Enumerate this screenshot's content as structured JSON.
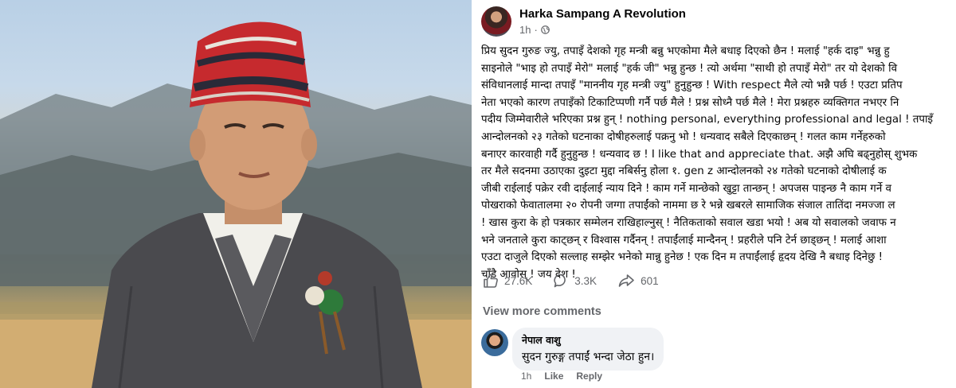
{
  "post": {
    "author": "Harka Sampang A Revolution",
    "time": "1h",
    "privacy_icon": "globe-icon",
    "lines": [
      "प्रिय सुदन गुरुङ ज्यु, तपाइँ देशको गृह मन्त्री बन्नु भएकोमा मैले बधाइ दिएको छैन ! मलाई \"हर्क दाइ\" भन्नु हु",
      "साइनोले \"भाइ हो तपाइँ मेरो\" मलाई \"हर्क जी\" भन्नु हुन्छ ! त्यो अर्थमा \"साथी हो तपाइँ मेरो\" तर यो देशको वि",
      "संविधानलाई मान्दा तपाइँ \"माननीय गृह मन्त्री ज्यु\" हुनुहुन्छ ! With respect मैले त्यो भन्नै पर्छ ! एउटा प्रतिप",
      "नेता भएको कारण तपाइँको टिकाटिप्पणी गर्नै पर्छ मैले ! प्रश्न सोध्नै पर्छ मैले ! मेरा प्रश्नहरु व्यक्तिगत नभएर नि",
      "पदीय जिम्मेवारीले भरिएका प्रश्न हुन् ! nothing personal, everything professional and legal ! तपाइँ",
      "आन्दोलनको २३ गतेको घटनाका दोषीहरुलाई पक्रनु भो ! धन्यवाद सबैले दिएकाछन् ! गलत काम गर्नेहरुको",
      "बनाएर कारवाही गर्दै हुनुहुन्छ ! धन्यवाद छ ! I like that and appreciate that. अझै अघि बढ्नुहोस् शुभक",
      "तर मैले सदनमा उठाएका दुइटा मुद्दा नबिर्सनु होला १. gen z आन्दोलनको २४ गतेको घटनाको दोषीलाई क",
      "जीबी राईलाई पक्रेर रवी दाईलाई न्याय दिने ! काम गर्ने मान्छेको खुट्टा तान्छन् ! अपजस पाइन्छ नै काम गर्ने व",
      "पोखराको फेवातालमा २० रोपनी जग्गा तपाईंको नाममा छ रे भन्ने खबरले सामाजिक संजाल तातिंदा नमज्जा ल",
      "! खास कुरा के हो पत्रकार सम्मेलन राखिहाल्नुस् ! नैतिकताको सवाल खडा भयो ! अब यो सवालको जवाफ न",
      "भने जनताले कुरा काट्छन् र विश्वास गर्दैनन् ! तपाईंलाई मान्दैनन् ! प्रहरीले पनि टेर्न छाड्छन् ! मलाई आशा",
      "एउटा दाजुले दिएको सल्लाह सम्झेर भनेको मान्नु हुनेछ ! एक दिन म तपाईंलाई हृदय देखि नै बधाइ दिनेछु ! ",
      "चाँडै आवोस् ! जय देश !"
    ],
    "stats": {
      "likes": "27.6K",
      "comments": "3.3K",
      "shares": "601"
    },
    "view_more": "View more comments"
  },
  "comment": {
    "name": "नेपाल वाशु",
    "text": "सुदन गुरुङ्ग तपाईं भन्दा जेठा हुन।",
    "time": "1h",
    "like_label": "Like",
    "reply_label": "Reply"
  },
  "colors": {
    "hat_red": "#c62a2e",
    "hat_dark": "#2a2a38",
    "jacket": "#4a4a4e",
    "secondary_text": "#65676b",
    "bubble_bg": "#f0f2f5"
  }
}
